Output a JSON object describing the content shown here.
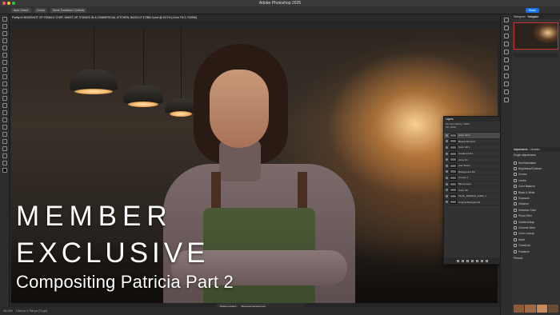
{
  "window": {
    "title": "Adobe Photoshop 2025",
    "traffic_lights": [
      "#ff5f57",
      "#febc2e",
      "#28c840"
    ]
  },
  "options_bar": {
    "auto_select_label": "Auto-Select:",
    "group_value": "Group",
    "transform_controls_label": "Show Transform Controls",
    "share_label": "Share"
  },
  "document": {
    "tab_title": "Firefly A HEADSHOT OF FEMALE CHEF, WAIST UP, STANDS IN A COMMERCIAL KITCHEN, BACKLIT 47386-2.psd @ 45.2% (Color Fill 2, RGB/8)"
  },
  "overlay": {
    "line1": "MEMBER",
    "line2": "EXCLUSIVE",
    "line3": "Compositing Patricia Part 2"
  },
  "contextual_taskbar": {
    "select_subject": "Select subject",
    "remove_background": "Remove background"
  },
  "status": {
    "zoom": "45.18%",
    "dimensions": "1344 px x 768 px (72 ppi)"
  },
  "right_panel": {
    "tabs": [
      "Histogram",
      "Navigator"
    ],
    "active_tab": "Navigator",
    "adjustments_tabs": [
      "Adjustments",
      "Libraries"
    ],
    "single_adjustments_label": "Single adjustments",
    "adjustments": [
      "Hue/Saturation",
      "Brightness/Contrast",
      "Curves",
      "Levels",
      "Color Balance",
      "Black & White",
      "Exposure",
      "Vibrance",
      "Selective Color",
      "Photo Filter",
      "Gradient Map",
      "Channel Mixer",
      "Color Lookup",
      "Invert",
      "Threshold",
      "Posterize"
    ],
    "presets_label": "Presets"
  },
  "layers_panel": {
    "title": "Layers",
    "blend_mode": "Normal",
    "opacity_label": "Opacity: 100%",
    "fill_label": "Fill: 100%",
    "layers": [
      {
        "name": "Color Fill 2",
        "selected": true
      },
      {
        "name": "Beauty Retouch",
        "selected": false
      },
      {
        "name": "Color Fill 1",
        "selected": false
      },
      {
        "name": "Gradient Fill 1",
        "selected": false
      },
      {
        "name": "Arms Fix",
        "selected": false
      },
      {
        "name": "Hair Sheen",
        "selected": false
      },
      {
        "name": "Background Fill",
        "selected": false
      },
      {
        "name": "Curves 1",
        "selected": false
      },
      {
        "name": "Blend Layer",
        "selected": false
      },
      {
        "name": "Color Fill",
        "selected": false
      },
      {
        "name": "Firefly_FEMALE_CHEF_1",
        "selected": false
      },
      {
        "name": "Original Background",
        "selected": false
      }
    ]
  },
  "swatch_colors": [
    "#8a5a3a",
    "#a06a44",
    "#c58b5a",
    "#6b4a34"
  ]
}
